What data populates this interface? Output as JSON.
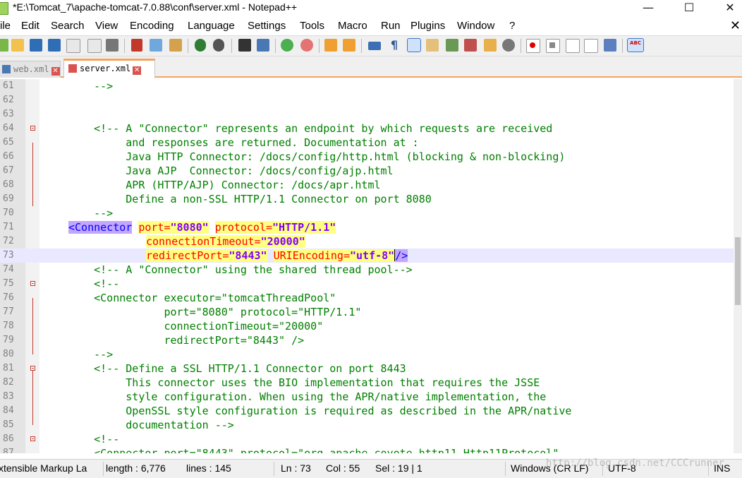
{
  "window": {
    "title": "*E:\\Tomcat_7\\apache-tomcat-7.0.88\\conf\\server.xml - Notepad++",
    "minimize_glyph": "—",
    "maximize_glyph": "☐",
    "close_glyph": "✕"
  },
  "menu": {
    "items": [
      "ile",
      "Edit",
      "Search",
      "View",
      "Encoding",
      "Language",
      "Settings",
      "Tools",
      "Macro",
      "Run",
      "Plugins",
      "Window",
      "?"
    ],
    "close_glyph": "✕"
  },
  "toolbar": {
    "icons": [
      "new-file-icon",
      "open-file-icon",
      "save-icon",
      "save-all-icon",
      "close-icon",
      "close-all-icon",
      "print-icon",
      "cut-icon",
      "copy-icon",
      "paste-icon",
      "undo-icon",
      "redo-icon",
      "find-icon",
      "replace-icon",
      "zoom-in-icon",
      "zoom-out-icon",
      "sync-vertical-icon",
      "sync-horizontal-icon",
      "word-wrap-icon",
      "show-all-chars-icon",
      "indent-guide-icon",
      "user-language-icon",
      "document-map-icon",
      "function-list-icon",
      "folder-as-workspace-icon",
      "monitoring-icon",
      "record-macro-icon",
      "stop-record-icon",
      "playback-macro-icon",
      "run-macro-multiple-icon",
      "save-macro-icon",
      "spell-check-icon"
    ],
    "spell_label": "ABC"
  },
  "tabs": [
    {
      "label": "web.xml",
      "active": false,
      "close_glyph": "✕"
    },
    {
      "label": "server.xml",
      "active": true,
      "close_glyph": "✕"
    }
  ],
  "editor": {
    "current_line": 73,
    "line_numbers": [
      "61",
      "62",
      "63",
      "64",
      "65",
      "66",
      "67",
      "68",
      "69",
      "70",
      "71",
      "72",
      "73",
      "74",
      "75",
      "76",
      "77",
      "78",
      "79",
      "80",
      "81",
      "82",
      "83",
      "84",
      "85",
      "86",
      "87"
    ],
    "lines": {
      "l61": "    -->",
      "l64": "    <!-- A \"Connector\" represents an endpoint by which requests are received",
      "l65": "         and responses are returned. Documentation at :",
      "l66": "         Java HTTP Connector: /docs/config/http.html (blocking & non-blocking)",
      "l67": "         Java AJP  Connector: /docs/config/ajp.html",
      "l68": "         APR (HTTP/AJP) Connector: /docs/apr.html",
      "l69": "         Define a non-SSL HTTP/1.1 Connector on port 8080",
      "l70": "    -->",
      "l71_tag": "<Connector",
      "l71_attr1": "port=",
      "l71_val1": "\"8080\"",
      "l71_attr2": "protocol=",
      "l71_val2": "\"HTTP/1.1\"",
      "l72_attr": "connectionTimeout=",
      "l72_val": "\"20000\"",
      "l73_attr1": "redirectPort=",
      "l73_val1": "\"8443\"",
      "l73_attr2": "URIEncoding=",
      "l73_val2": "\"utf-8\"",
      "l73_end": "/>",
      "l74": "    <!-- A \"Connector\" using the shared thread pool-->",
      "l75": "    <!--",
      "l76": "    <Connector executor=\"tomcatThreadPool\"",
      "l77": "               port=\"8080\" protocol=\"HTTP/1.1\"",
      "l78": "               connectionTimeout=\"20000\"",
      "l79": "               redirectPort=\"8443\" />",
      "l80": "    -->",
      "l81": "    <!-- Define a SSL HTTP/1.1 Connector on port 8443",
      "l82": "         This connector uses the BIO implementation that requires the JSSE",
      "l83": "         style configuration. When using the APR/native implementation, the",
      "l84": "         OpenSSL style configuration is required as described in the APR/native",
      "l85": "         documentation -->",
      "l86": "    <!--",
      "l87": "    <Connector port=\"8443\" protocol=\"org.apache.coyote.http11.Http11Protocol\""
    }
  },
  "statusbar": {
    "language": "xtensible Markup La",
    "length": "length : 6,776",
    "lines": "lines : 145",
    "ln": "Ln : 73",
    "col": "Col : 55",
    "sel": "Sel : 19 | 1",
    "eol": "Windows (CR LF)",
    "encoding": "UTF-8",
    "mode": "INS"
  },
  "watermark": "http://blog.csdn.net/CCCrunner",
  "colors": {
    "comment": "#008000",
    "tag": "#0000ff",
    "attribute": "#ff0000",
    "value": "#8000ff",
    "tab_accent": "#f4a460",
    "current_line": "#e8e8ff",
    "match_highlight": "#ffff80"
  }
}
